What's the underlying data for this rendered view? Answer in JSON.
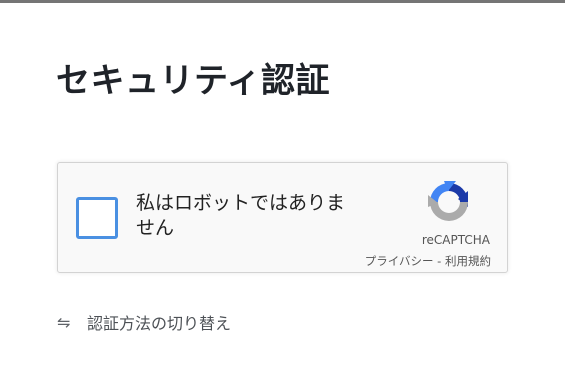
{
  "page": {
    "title": "セキュリティ認証"
  },
  "captcha": {
    "checkbox_label": "私はロボットではありません",
    "brand": "reCAPTCHA",
    "privacy_link": "プライバシー",
    "separator": " - ",
    "terms_link": "利用規約",
    "checked": false
  },
  "switch_method": {
    "icon": "swap-arrows-icon",
    "label": "認証方法の切り替え"
  },
  "colors": {
    "checkbox_border": "#4a90e2",
    "title": "#1f2329",
    "recaptcha_blue": "#1c3aa9",
    "recaptcha_lightblue": "#4285f4",
    "recaptcha_gray": "#ababab"
  }
}
